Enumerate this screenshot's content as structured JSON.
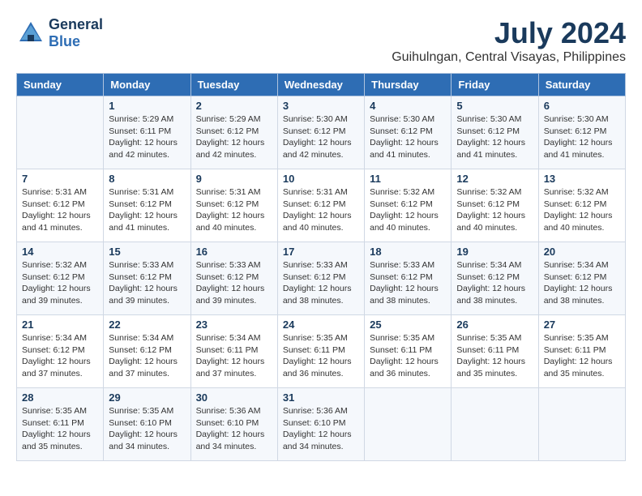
{
  "header": {
    "logo_line1": "General",
    "logo_line2": "Blue",
    "month_year": "July 2024",
    "location": "Guihulngan, Central Visayas, Philippines"
  },
  "days_of_week": [
    "Sunday",
    "Monday",
    "Tuesday",
    "Wednesday",
    "Thursday",
    "Friday",
    "Saturday"
  ],
  "weeks": [
    [
      {
        "day": "",
        "sunrise": "",
        "sunset": "",
        "daylight": ""
      },
      {
        "day": "1",
        "sunrise": "Sunrise: 5:29 AM",
        "sunset": "Sunset: 6:11 PM",
        "daylight": "Daylight: 12 hours and 42 minutes."
      },
      {
        "day": "2",
        "sunrise": "Sunrise: 5:29 AM",
        "sunset": "Sunset: 6:12 PM",
        "daylight": "Daylight: 12 hours and 42 minutes."
      },
      {
        "day": "3",
        "sunrise": "Sunrise: 5:30 AM",
        "sunset": "Sunset: 6:12 PM",
        "daylight": "Daylight: 12 hours and 42 minutes."
      },
      {
        "day": "4",
        "sunrise": "Sunrise: 5:30 AM",
        "sunset": "Sunset: 6:12 PM",
        "daylight": "Daylight: 12 hours and 41 minutes."
      },
      {
        "day": "5",
        "sunrise": "Sunrise: 5:30 AM",
        "sunset": "Sunset: 6:12 PM",
        "daylight": "Daylight: 12 hours and 41 minutes."
      },
      {
        "day": "6",
        "sunrise": "Sunrise: 5:30 AM",
        "sunset": "Sunset: 6:12 PM",
        "daylight": "Daylight: 12 hours and 41 minutes."
      }
    ],
    [
      {
        "day": "7",
        "sunrise": "Sunrise: 5:31 AM",
        "sunset": "Sunset: 6:12 PM",
        "daylight": "Daylight: 12 hours and 41 minutes."
      },
      {
        "day": "8",
        "sunrise": "Sunrise: 5:31 AM",
        "sunset": "Sunset: 6:12 PM",
        "daylight": "Daylight: 12 hours and 41 minutes."
      },
      {
        "day": "9",
        "sunrise": "Sunrise: 5:31 AM",
        "sunset": "Sunset: 6:12 PM",
        "daylight": "Daylight: 12 hours and 40 minutes."
      },
      {
        "day": "10",
        "sunrise": "Sunrise: 5:31 AM",
        "sunset": "Sunset: 6:12 PM",
        "daylight": "Daylight: 12 hours and 40 minutes."
      },
      {
        "day": "11",
        "sunrise": "Sunrise: 5:32 AM",
        "sunset": "Sunset: 6:12 PM",
        "daylight": "Daylight: 12 hours and 40 minutes."
      },
      {
        "day": "12",
        "sunrise": "Sunrise: 5:32 AM",
        "sunset": "Sunset: 6:12 PM",
        "daylight": "Daylight: 12 hours and 40 minutes."
      },
      {
        "day": "13",
        "sunrise": "Sunrise: 5:32 AM",
        "sunset": "Sunset: 6:12 PM",
        "daylight": "Daylight: 12 hours and 40 minutes."
      }
    ],
    [
      {
        "day": "14",
        "sunrise": "Sunrise: 5:32 AM",
        "sunset": "Sunset: 6:12 PM",
        "daylight": "Daylight: 12 hours and 39 minutes."
      },
      {
        "day": "15",
        "sunrise": "Sunrise: 5:33 AM",
        "sunset": "Sunset: 6:12 PM",
        "daylight": "Daylight: 12 hours and 39 minutes."
      },
      {
        "day": "16",
        "sunrise": "Sunrise: 5:33 AM",
        "sunset": "Sunset: 6:12 PM",
        "daylight": "Daylight: 12 hours and 39 minutes."
      },
      {
        "day": "17",
        "sunrise": "Sunrise: 5:33 AM",
        "sunset": "Sunset: 6:12 PM",
        "daylight": "Daylight: 12 hours and 38 minutes."
      },
      {
        "day": "18",
        "sunrise": "Sunrise: 5:33 AM",
        "sunset": "Sunset: 6:12 PM",
        "daylight": "Daylight: 12 hours and 38 minutes."
      },
      {
        "day": "19",
        "sunrise": "Sunrise: 5:34 AM",
        "sunset": "Sunset: 6:12 PM",
        "daylight": "Daylight: 12 hours and 38 minutes."
      },
      {
        "day": "20",
        "sunrise": "Sunrise: 5:34 AM",
        "sunset": "Sunset: 6:12 PM",
        "daylight": "Daylight: 12 hours and 38 minutes."
      }
    ],
    [
      {
        "day": "21",
        "sunrise": "Sunrise: 5:34 AM",
        "sunset": "Sunset: 6:12 PM",
        "daylight": "Daylight: 12 hours and 37 minutes."
      },
      {
        "day": "22",
        "sunrise": "Sunrise: 5:34 AM",
        "sunset": "Sunset: 6:12 PM",
        "daylight": "Daylight: 12 hours and 37 minutes."
      },
      {
        "day": "23",
        "sunrise": "Sunrise: 5:34 AM",
        "sunset": "Sunset: 6:11 PM",
        "daylight": "Daylight: 12 hours and 37 minutes."
      },
      {
        "day": "24",
        "sunrise": "Sunrise: 5:35 AM",
        "sunset": "Sunset: 6:11 PM",
        "daylight": "Daylight: 12 hours and 36 minutes."
      },
      {
        "day": "25",
        "sunrise": "Sunrise: 5:35 AM",
        "sunset": "Sunset: 6:11 PM",
        "daylight": "Daylight: 12 hours and 36 minutes."
      },
      {
        "day": "26",
        "sunrise": "Sunrise: 5:35 AM",
        "sunset": "Sunset: 6:11 PM",
        "daylight": "Daylight: 12 hours and 35 minutes."
      },
      {
        "day": "27",
        "sunrise": "Sunrise: 5:35 AM",
        "sunset": "Sunset: 6:11 PM",
        "daylight": "Daylight: 12 hours and 35 minutes."
      }
    ],
    [
      {
        "day": "28",
        "sunrise": "Sunrise: 5:35 AM",
        "sunset": "Sunset: 6:11 PM",
        "daylight": "Daylight: 12 hours and 35 minutes."
      },
      {
        "day": "29",
        "sunrise": "Sunrise: 5:35 AM",
        "sunset": "Sunset: 6:10 PM",
        "daylight": "Daylight: 12 hours and 34 minutes."
      },
      {
        "day": "30",
        "sunrise": "Sunrise: 5:36 AM",
        "sunset": "Sunset: 6:10 PM",
        "daylight": "Daylight: 12 hours and 34 minutes."
      },
      {
        "day": "31",
        "sunrise": "Sunrise: 5:36 AM",
        "sunset": "Sunset: 6:10 PM",
        "daylight": "Daylight: 12 hours and 34 minutes."
      },
      {
        "day": "",
        "sunrise": "",
        "sunset": "",
        "daylight": ""
      },
      {
        "day": "",
        "sunrise": "",
        "sunset": "",
        "daylight": ""
      },
      {
        "day": "",
        "sunrise": "",
        "sunset": "",
        "daylight": ""
      }
    ]
  ]
}
